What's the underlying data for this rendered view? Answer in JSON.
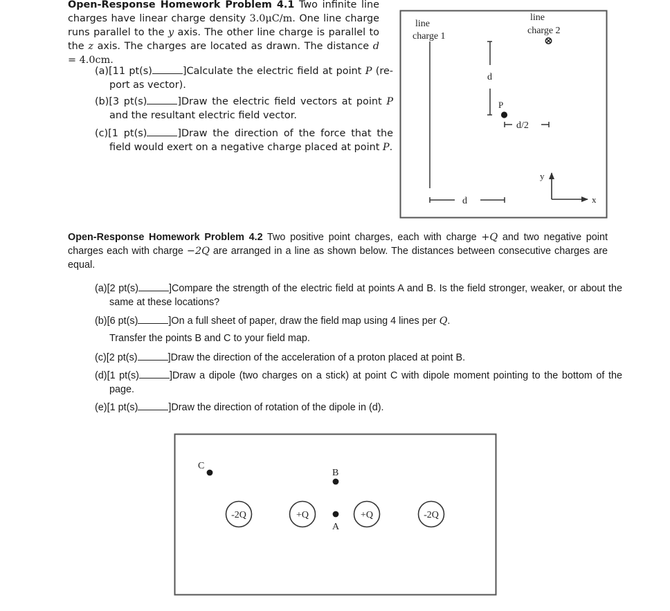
{
  "problem_41": {
    "heading": "Open-Response Homework Problem 4.1",
    "intro_1": " Two infinite line charges have linear charge density ",
    "charge_density": "3.0μC/m",
    "intro_2": ". One line charge runs parallel to the ",
    "axis_y": "y",
    "intro_3": " axis. The other line charge is parallel to the ",
    "axis_z": "z",
    "intro_4": " axis. The charges are located as drawn. The distance ",
    "distance_var": "d",
    "distance_eq": " = 4.0cm",
    "intro_end": ".",
    "parts": [
      {
        "label": "(a)[11 pt(s)",
        "close": "]",
        "text_1": "Calculate the electric field at point ",
        "var": "P",
        "text_2": " (re- port as vector)."
      },
      {
        "label": "(b)[3 pt(s)",
        "close": "]",
        "text_1": "Draw the electric field vectors at point ",
        "var": "P",
        "text_2": " and the resultant electric field vector."
      },
      {
        "label": "(c)[1 pt(s)",
        "close": "]",
        "text_1": "Draw the direction of the force that the field would exert on a negative charge placed at point ",
        "var": "P",
        "text_2": "."
      }
    ],
    "figure": {
      "line_charge_1_label": [
        "line",
        "charge 1"
      ],
      "line_charge_2_label": [
        "line",
        "charge 2"
      ],
      "into_page_symbol": "⊗",
      "vertical_distance_label": "d",
      "point_label": "P",
      "half_distance_label": "d/2",
      "horizontal_distance_label": "d",
      "axis_y_label": "y",
      "axis_x_label": "x"
    }
  },
  "problem_42": {
    "heading": "Open-Response Homework Problem 4.2",
    "intro_1": " Two positive point charges, each with charge ",
    "pos_charge": "+Q",
    "intro_2": " and two negative point charges each with charge ",
    "neg_charge": "−2Q",
    "intro_3": " are arranged in a line as shown below. The distances between consecutive charges are equal.",
    "parts": [
      {
        "label": "(a)[2 pt(s)",
        "close": "]",
        "text": "Compare the strength of the electric field at points A and B. Is the field stronger, weaker, or about the same at these locations?"
      },
      {
        "label": "(b)[6 pt(s)",
        "close": "]",
        "text_1": "On a full sheet of paper, draw the field map using 4 lines per ",
        "var": "Q",
        "text_2": ".",
        "followup": "Transfer the points B and C to your field map."
      },
      {
        "label": "(c)[2 pt(s)",
        "close": "]",
        "text": "Draw the direction of the acceleration of a proton placed at point B."
      },
      {
        "label": "(d)[1 pt(s)",
        "close": "]",
        "text": "Draw a dipole (two charges on a stick) at point C with dipole moment pointing to the bottom of the page."
      },
      {
        "label": "(e)[1 pt(s)",
        "close": "]",
        "text": "Draw the direction of rotation of the dipole in (d)."
      }
    ],
    "figure": {
      "charges": [
        "-2Q",
        "+Q",
        "+Q",
        "-2Q"
      ],
      "point_a_label": "A",
      "point_b_label": "B",
      "point_c_label": "C"
    }
  }
}
